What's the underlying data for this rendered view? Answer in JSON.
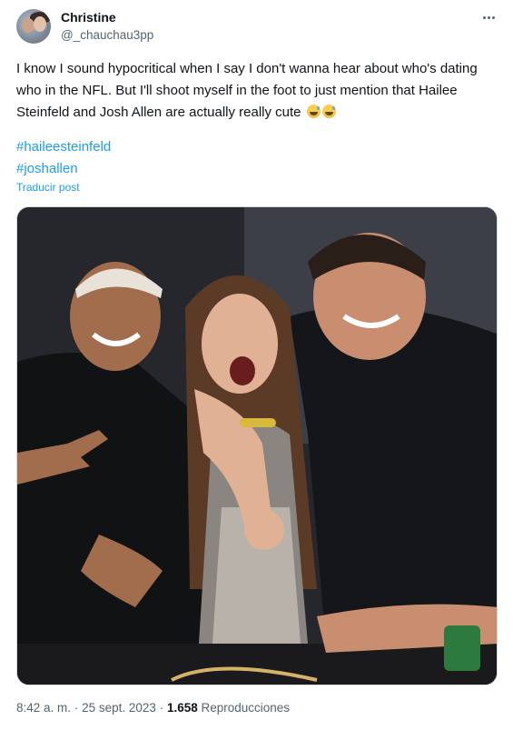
{
  "author": {
    "name": "Christine",
    "handle": "@_chauchau3pp"
  },
  "post": {
    "text": "I know I sound hypocritical when I say I don't wanna hear about who's dating who in the NFL. But I'll shoot myself in the foot to just mention that Hailee Steinfeld and Josh Allen are actually really cute",
    "emoji": [
      "grinning-face-with-sweat",
      "grinning-face-with-sweat"
    ],
    "hashtags": [
      "#haileesteinfeld",
      "#joshallen"
    ],
    "translate_label": "Traducir post"
  },
  "photo": {
    "description_icon": "photo-of-three-people"
  },
  "meta": {
    "time": "8:42 a. m.",
    "separator": "·",
    "date": "25 sept. 2023",
    "views_count": "1.658",
    "views_label": "Reproducciones"
  },
  "colors": {
    "link": "#1d9bf0",
    "secondary": "#536471",
    "primary_text": "#0f1419"
  }
}
